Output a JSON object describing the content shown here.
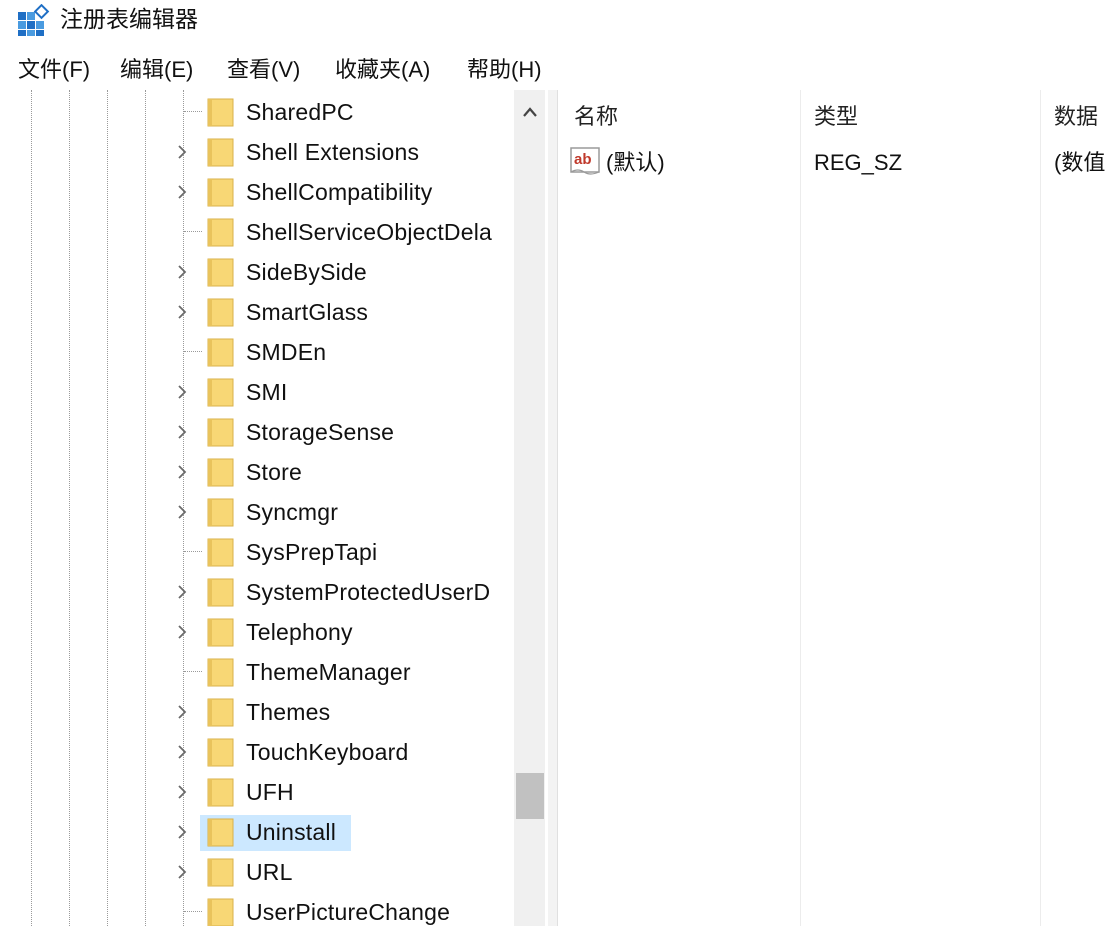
{
  "window": {
    "title": "注册表编辑器",
    "icon": "registry-editor-icon"
  },
  "menu": [
    "文件(F)",
    "编辑(E)",
    "查看(V)",
    "收藏夹(A)",
    "帮助(H)"
  ],
  "tree": {
    "items": [
      {
        "label": "SharedPC",
        "expandable": false
      },
      {
        "label": "Shell Extensions",
        "expandable": true
      },
      {
        "label": "ShellCompatibility",
        "expandable": true
      },
      {
        "label": "ShellServiceObjectDela",
        "expandable": false
      },
      {
        "label": "SideBySide",
        "expandable": true
      },
      {
        "label": "SmartGlass",
        "expandable": true
      },
      {
        "label": "SMDEn",
        "expandable": false
      },
      {
        "label": "SMI",
        "expandable": true
      },
      {
        "label": "StorageSense",
        "expandable": true
      },
      {
        "label": "Store",
        "expandable": true
      },
      {
        "label": "Syncmgr",
        "expandable": true
      },
      {
        "label": "SysPrepTapi",
        "expandable": false
      },
      {
        "label": "SystemProtectedUserD",
        "expandable": true
      },
      {
        "label": "Telephony",
        "expandable": true
      },
      {
        "label": "ThemeManager",
        "expandable": false
      },
      {
        "label": "Themes",
        "expandable": true
      },
      {
        "label": "TouchKeyboard",
        "expandable": true
      },
      {
        "label": "UFH",
        "expandable": true
      },
      {
        "label": "Uninstall",
        "expandable": true,
        "selected": true
      },
      {
        "label": "URL",
        "expandable": true
      },
      {
        "label": "UserPictureChange",
        "expandable": false
      }
    ],
    "folder_color": "#f8d775",
    "selection_color": "#cce8ff"
  },
  "list": {
    "columns": [
      "名称",
      "类型",
      "数据"
    ],
    "rows": [
      {
        "name": "(默认)",
        "type": "REG_SZ",
        "data": "(数值",
        "icon": "string-value-icon"
      }
    ]
  }
}
